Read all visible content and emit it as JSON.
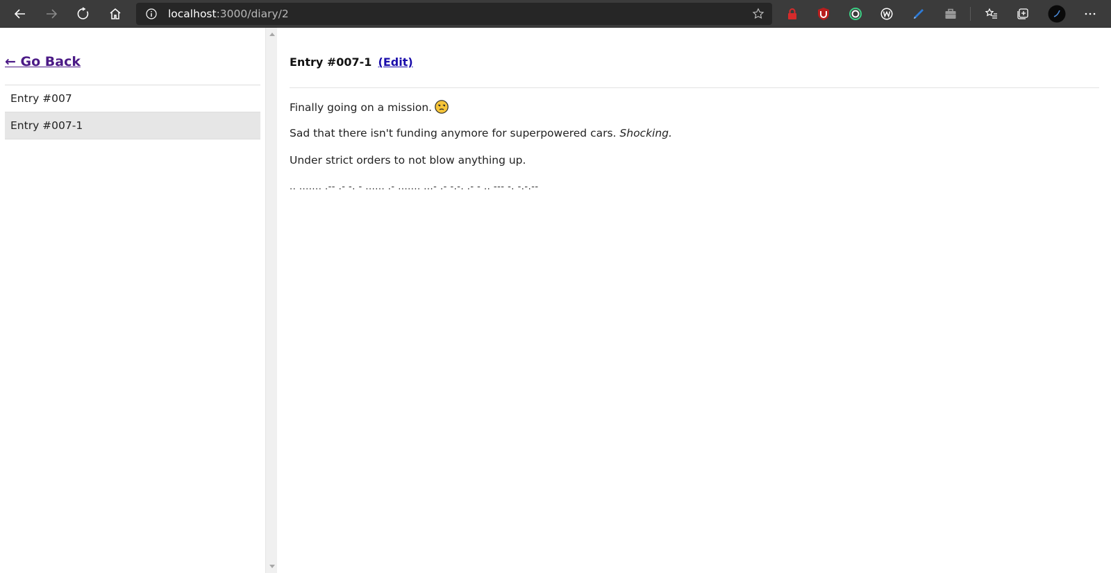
{
  "browser": {
    "url_host": "localhost",
    "url_path": ":3000/diary/2",
    "colors": {
      "toolbar_bg": "#3b3b3b",
      "address_bg": "#262626"
    },
    "icons": [
      "back-icon",
      "forward-icon",
      "refresh-icon",
      "home-icon",
      "info-icon",
      "favorite-star-icon",
      "lock-extension-icon",
      "ublock-extension-icon",
      "ring-extension-icon",
      "w-extension-icon",
      "pen-extension-icon",
      "briefcase-extension-icon",
      "favorites-list-icon",
      "collections-icon",
      "profile-avatar-icon",
      "more-options-icon"
    ]
  },
  "sidebar": {
    "back_label": "← Go Back",
    "items": [
      {
        "label": "Entry #007",
        "active": false
      },
      {
        "label": "Entry #007-1",
        "active": true
      }
    ]
  },
  "entry": {
    "title": "Entry #007-1",
    "edit_label": "(Edit)",
    "paragraph_1": "Finally going on a mission.",
    "paragraph_1_emoji": "unamused-face-icon",
    "paragraph_2_text": "Sad that there isn't funding anymore for superpowered cars. ",
    "paragraph_2_emphasis": "Shocking.",
    "paragraph_3": "Under strict orders to not blow anything up.",
    "paragraph_4": ".. ....... .-- .- -. - ...... .- ....... ...- .- -.-. .- - .. --- -. -.-.--"
  },
  "colors": {
    "link_visited": "#4b1a86",
    "link_edit": "#1a0dab",
    "active_item_bg": "#e6e6e6"
  }
}
